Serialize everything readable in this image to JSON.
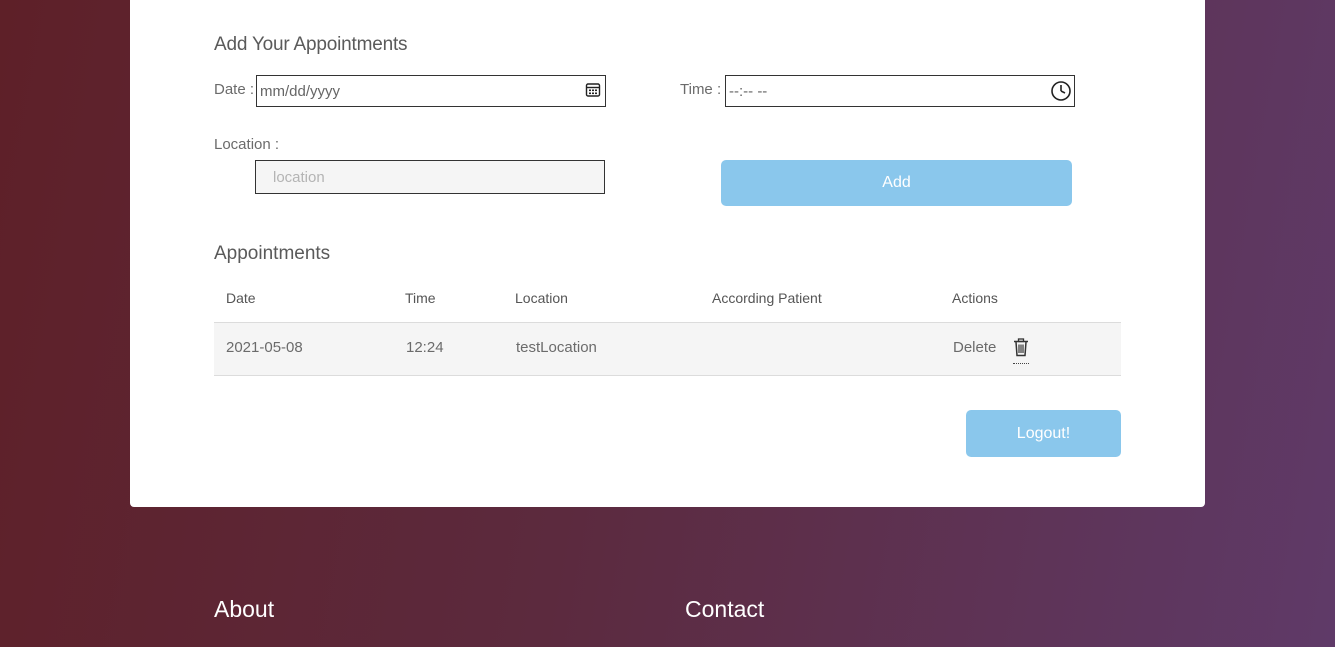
{
  "form": {
    "title": "Add Your Appointments",
    "date_label": "Date :",
    "date_placeholder": "mm/dd/yyyy",
    "time_label": "Time :",
    "time_placeholder": "--:-- --",
    "location_label": "Location :",
    "location_placeholder": "location",
    "add_button": "Add"
  },
  "appointments": {
    "title": "Appointments",
    "columns": [
      "Date",
      "Time",
      "Location",
      "According Patient",
      "Actions"
    ],
    "rows": [
      {
        "date": "2021-05-08",
        "time": "12:24",
        "location": "testLocation",
        "patient": "",
        "action": "Delete"
      }
    ]
  },
  "logout_button": "Logout!",
  "footer": {
    "about": "About",
    "contact": "Contact"
  },
  "icons": {
    "date_field": "calendar-icon",
    "time_field": "clock-icon",
    "delete": "trash-icon"
  },
  "colors": {
    "button": "#8ac7ec",
    "card": "#ffffff",
    "background_start": "#5e2028",
    "background_end": "#5f3a68"
  }
}
